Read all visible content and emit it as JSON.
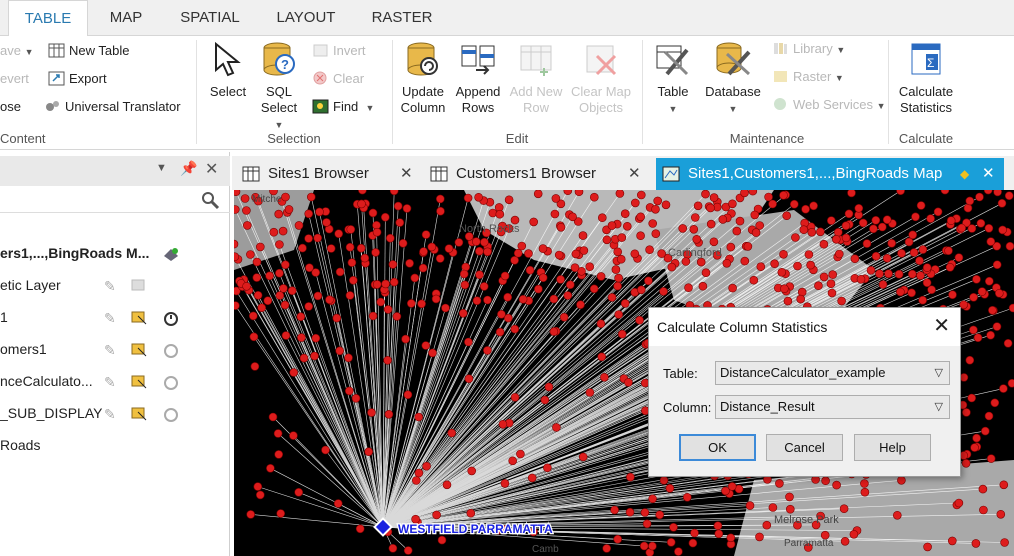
{
  "ribbon_tabs": [
    "TABLE",
    "MAP",
    "SPATIAL",
    "LAYOUT",
    "RASTER"
  ],
  "ribbon": {
    "content": {
      "label": "Content",
      "rows": [
        "ave",
        "evert",
        "ose"
      ]
    },
    "content2": {
      "new_table": "New Table",
      "export": "Export",
      "universal_translator": "Universal Translator"
    },
    "selection": {
      "label": "Selection",
      "select": "Select",
      "sql_select_1": "SQL",
      "sql_select_2": "Select",
      "invert": "Invert",
      "clear": "Clear",
      "find": "Find"
    },
    "edit": {
      "label": "Edit",
      "update_1": "Update",
      "update_2": "Column",
      "append_1": "Append",
      "append_2": "Rows",
      "add_new_1": "Add New",
      "add_new_2": "Row",
      "clear_map_1": "Clear Map",
      "clear_map_2": "Objects"
    },
    "maintenance": {
      "label": "Maintenance",
      "table": "Table",
      "database": "Database",
      "library": "Library",
      "raster": "Raster",
      "web_services": "Web Services"
    },
    "calculate": {
      "label": "Calculate",
      "calc_1": "Calculate",
      "calc_2": "Statistics"
    }
  },
  "layers": {
    "items": [
      "ers1,...,BingRoads M...",
      "etic Layer",
      "1",
      "omers1",
      "nceCalculato...",
      "_SUB_DISPLAY",
      "Roads"
    ]
  },
  "doc_tabs": [
    "Sites1 Browser",
    "Customers1 Browser",
    "Sites1,Customers1,...,BingRoads Map"
  ],
  "map": {
    "labels": {
      "north_rocks": "North Rocks",
      "carlingford": "Carlingford",
      "melrose_park": "Melrose Park",
      "westfield": "WESTFIELD PARRAMATTA",
      "parramatta": "Parramatta",
      "mitchell": "Mitche",
      "cambridge": "Camb"
    },
    "colors": {
      "point": "#dd1c1c",
      "store": "#1a22e0"
    }
  },
  "dialog": {
    "title": "Calculate Column Statistics",
    "table_label": "Table:",
    "table_value": "DistanceCalculator_example",
    "column_label": "Column:",
    "column_value": "Distance_Result",
    "ok": "OK",
    "cancel": "Cancel",
    "help": "Help"
  }
}
